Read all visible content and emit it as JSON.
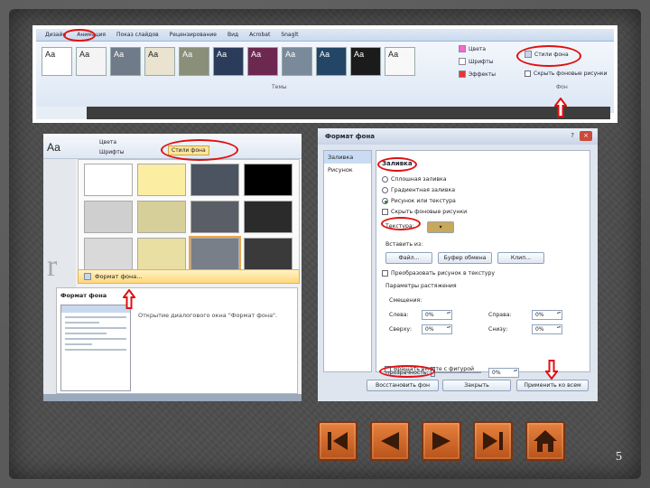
{
  "ribbon": {
    "tabs": [
      "Дизайн",
      "Анимация",
      "Показ слайдов",
      "Рецензирование",
      "Вид",
      "Acrobat",
      "Snaglt"
    ],
    "theme_tiles": [
      "Аа",
      "Аа",
      "Аа",
      "Аа",
      "Аа",
      "Аа",
      "Аа",
      "Аа",
      "Аа",
      "Аа",
      "Аа",
      "Аа"
    ],
    "colors_label": "Цвета",
    "fonts_label": "Шрифты",
    "effects_label": "Эффекты",
    "bg_styles_label": "Стили фона",
    "hide_bg_label": "Скрыть фоновые рисунки",
    "group_themes": "Темы",
    "group_bg": "Фон"
  },
  "gallery": {
    "aa_label": "Аа",
    "colors_label": "Цвета",
    "fonts_label": "Шрифты",
    "bg_styles_label": "Стили фона",
    "menu_item_label": "Формат фона...",
    "tooltip_title": "Формат фона",
    "tooltip_text": "Открытие диалогового окна \"Формат фона\".",
    "left_letter": "r",
    "swatch_colors": [
      "#ffffff",
      "#fbeda2",
      "#4d5461",
      "#000000",
      "#cfcfcf",
      "#d7cf9a",
      "#5a5f67",
      "#2b2b2b",
      "#d9d9d9",
      "#e9dfa2",
      "#787f88",
      "#3a3a3a"
    ],
    "selected_swatch": 10
  },
  "dialog": {
    "title": "Формат фона",
    "help": "?",
    "close": "×",
    "nav": [
      "Заливка",
      "Рисунок"
    ],
    "heading": "Заливка",
    "radios": [
      "Сплошная заливка",
      "Градиентная заливка",
      "Рисунок или текстура",
      "Скрыть фоновые рисунки"
    ],
    "selected_radio": 2,
    "texture_label": "Текстура:",
    "insert_from_label": "Вставить из:",
    "btn_file": "Файл...",
    "btn_clipboard": "Буфер обмена",
    "btn_clip": "Клип...",
    "tile_check": "Преобразовать рисунок в текстуру",
    "stretch_label": "Параметры растяжения",
    "offsets_label": "Смещения:",
    "left_label": "Слева:",
    "right_label": "Справа:",
    "top_label": "Сверху:",
    "bottom_label": "Снизу:",
    "left_val": "0%",
    "right_val": "0%",
    "top_val": "0%",
    "bottom_val": "0%",
    "transparency_label": "Прозрачность:",
    "transparency_val": "0%",
    "rotate_check": "Вращать вместе с фигурой",
    "btn_restore": "Восстановить фон",
    "btn_close": "Закрыть",
    "btn_apply_all": "Применить ко всем"
  },
  "navigation": {
    "first": "first-slide",
    "prev": "previous-slide",
    "next": "next-slide",
    "last": "last-slide",
    "home": "home"
  },
  "page_number": "5",
  "colors": {
    "highlight": "#e01010",
    "nav_orange": "#d06a2a"
  }
}
